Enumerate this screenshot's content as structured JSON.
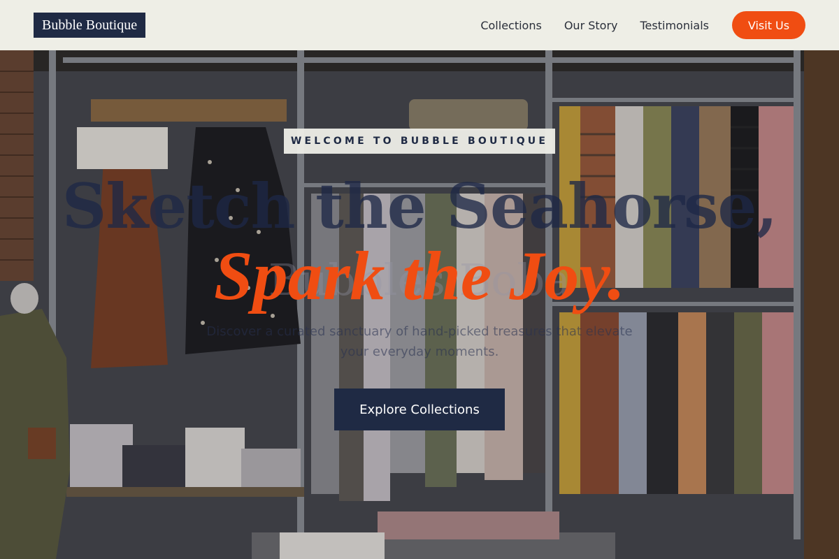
{
  "header": {
    "logo": "Bubble Boutique",
    "nav": [
      {
        "label": "Collections"
      },
      {
        "label": "Our Story"
      },
      {
        "label": "Testimonials"
      }
    ],
    "cta_label": "Visit Us"
  },
  "hero": {
    "badge": "WELCOME TO BUBBLE BOUTIQUE",
    "headline_line1": "Sketch the Seahorse,",
    "headline_line2": "Spark the Joy.",
    "ghost_text": "Bubbles Boba",
    "subtext": "Discover a curated sanctuary of hand-picked treasures that elevate your everyday moments.",
    "button_label": "Explore Collections",
    "background_image": "clothing-store-photo"
  },
  "colors": {
    "accent": "#f04d12",
    "navy": "#1f2a44",
    "header_bg": "#eeeee6"
  }
}
